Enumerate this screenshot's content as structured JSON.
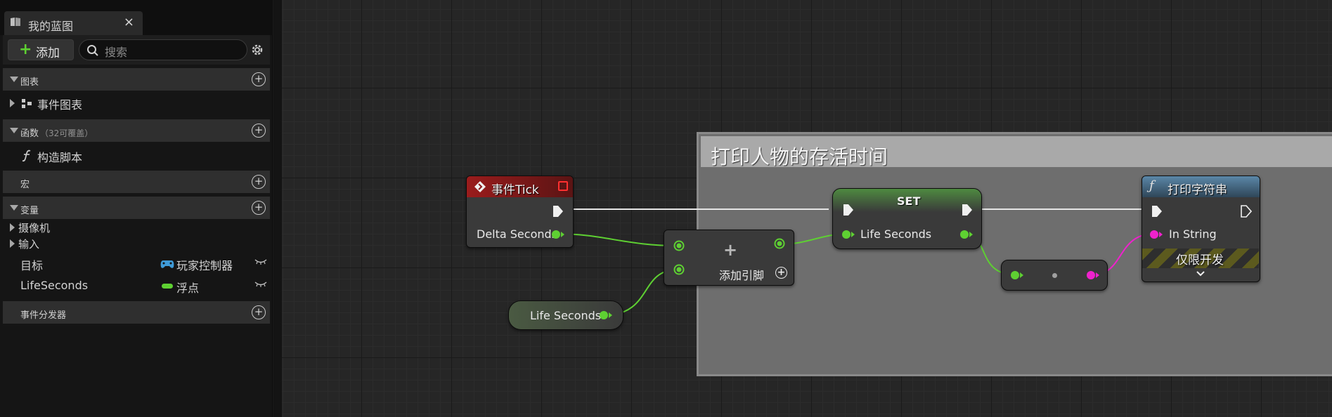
{
  "tab": {
    "title": "我的蓝图",
    "close": "×"
  },
  "toolbar": {
    "add_label": "添加",
    "search_placeholder": "搜索"
  },
  "sections": {
    "graphs": {
      "label": "图表",
      "items": [
        {
          "label": "事件图表"
        }
      ]
    },
    "functions": {
      "label": "函数",
      "sub": "（32可覆盖）",
      "items": [
        {
          "label": "构造脚本"
        }
      ]
    },
    "macros": {
      "label": "宏"
    },
    "variables": {
      "label": "变量",
      "categories": [
        {
          "label": "摄像机"
        },
        {
          "label": "输入"
        }
      ],
      "items": [
        {
          "name": "目标",
          "type": "玩家控制器",
          "type_color": "#3f9bd8"
        },
        {
          "name": "LifeSeconds",
          "type": "浮点",
          "type_color": "#5ed032"
        }
      ]
    },
    "dispatchers": {
      "label": "事件分发器"
    }
  },
  "graph": {
    "comment_title": "打印人物的存活时间",
    "event_tick": {
      "title": "事件Tick",
      "output_label": "Delta Seconds"
    },
    "add_node": {
      "add_pin_label": "添加引脚",
      "operator": "+"
    },
    "get_var": {
      "label": "Life Seconds"
    },
    "set_node": {
      "title": "SET",
      "pin_label": "Life Seconds"
    },
    "print_string": {
      "title": "打印字符串",
      "pin_label": "In String",
      "dev_only": "仅限开发"
    },
    "colors": {
      "exec": "#f0f0f0",
      "float_pin": "#5ed032",
      "string_pin": "#ee22cc",
      "event_header": "#8a1a1a",
      "function_header": "#4a6f8a",
      "set_header": "#4a8a3a"
    }
  }
}
